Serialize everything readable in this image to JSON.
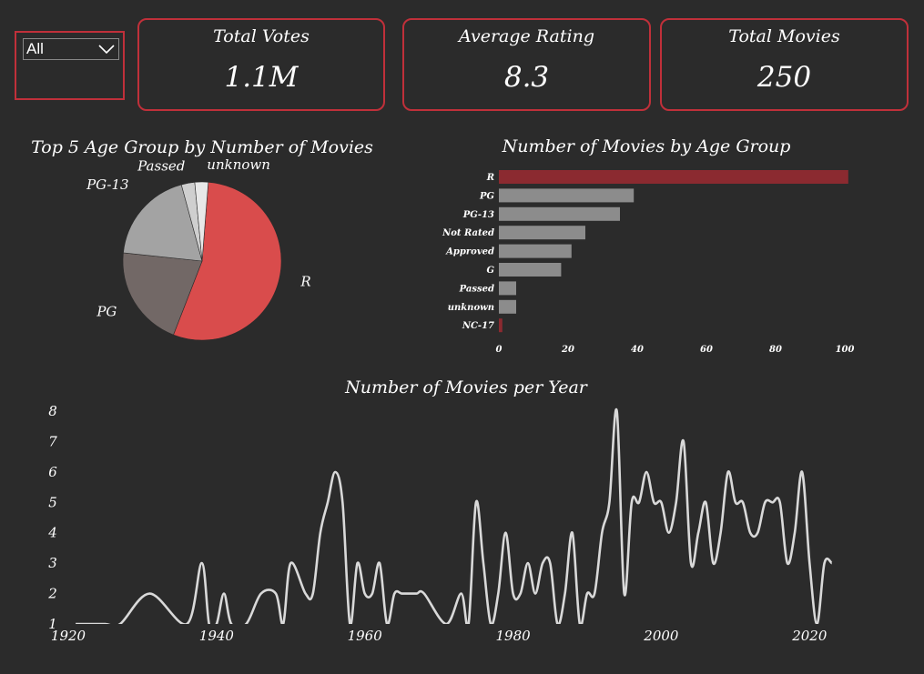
{
  "filter": {
    "selected": "All"
  },
  "cards": [
    {
      "title": "Total Votes",
      "value": "1.1M"
    },
    {
      "title": "Average Rating",
      "value": "8.3"
    },
    {
      "title": "Total Movies",
      "value": "250"
    }
  ],
  "colors": {
    "accent": "#c0303a",
    "background": "#2b2b2b",
    "bar_default": "#8c8c8c",
    "bar_highlight": "#8b2a30",
    "line": "#d9d9d9"
  },
  "chart_data": [
    {
      "type": "pie",
      "title": "Top 5 Age Group by Number of Movies",
      "categories": [
        "R",
        "PG",
        "PG-13",
        "Passed",
        "unknown"
      ],
      "values": [
        100,
        38,
        35,
        5,
        5
      ],
      "colors": [
        "#d94c4c",
        "#726866",
        "#a3a3a3",
        "#cfcfcf",
        "#e8e8e8"
      ]
    },
    {
      "type": "bar",
      "orientation": "horizontal",
      "title": "Number of Movies by Age Group",
      "categories": [
        "R",
        "PG",
        "PG-13",
        "Not Rated",
        "Approved",
        "G",
        "Passed",
        "unknown",
        "NC-17"
      ],
      "values": [
        101,
        39,
        35,
        25,
        21,
        18,
        5,
        5,
        1
      ],
      "highlight": [
        "R",
        "NC-17"
      ],
      "xticks": [
        0,
        20,
        40,
        60,
        80,
        100
      ],
      "xlim": [
        0,
        101
      ]
    },
    {
      "type": "line",
      "title": "Number of Movies per Year",
      "x": [
        1921,
        1922,
        1925,
        1927,
        1931,
        1936,
        1938,
        1939,
        1940,
        1941,
        1942,
        1944,
        1946,
        1948,
        1949,
        1950,
        1952,
        1953,
        1954,
        1955,
        1956,
        1957,
        1958,
        1959,
        1960,
        1961,
        1962,
        1963,
        1964,
        1965,
        1966,
        1967,
        1968,
        1971,
        1973,
        1974,
        1975,
        1976,
        1977,
        1978,
        1979,
        1980,
        1981,
        1982,
        1983,
        1984,
        1985,
        1986,
        1987,
        1988,
        1989,
        1990,
        1991,
        1992,
        1993,
        1994,
        1995,
        1996,
        1997,
        1998,
        1999,
        2000,
        2001,
        2002,
        2003,
        2004,
        2005,
        2006,
        2007,
        2008,
        2009,
        2010,
        2011,
        2012,
        2013,
        2014,
        2015,
        2016,
        2017,
        2018,
        2019,
        2020,
        2021,
        2022,
        2023
      ],
      "y": [
        1,
        1,
        1,
        1,
        2,
        1,
        3,
        1,
        1,
        2,
        1,
        1,
        2,
        2,
        1,
        3,
        2,
        2,
        4,
        5,
        6,
        5,
        1,
        3,
        2,
        2,
        3,
        1,
        2,
        2,
        2,
        2,
        2,
        1,
        2,
        1,
        5,
        3,
        1,
        2,
        4,
        2,
        2,
        3,
        2,
        3,
        3,
        1,
        2,
        4,
        1,
        2,
        2,
        4,
        5,
        8,
        2,
        5,
        5,
        6,
        5,
        5,
        4,
        5,
        7,
        3,
        4,
        5,
        3,
        4,
        6,
        5,
        5,
        4,
        4,
        5,
        5,
        5,
        3,
        4,
        6,
        3,
        1,
        3,
        3
      ],
      "yticks": [
        1,
        2,
        3,
        4,
        5,
        6,
        7,
        8
      ],
      "xticks": [
        1920,
        1940,
        1960,
        1980,
        2000,
        2020
      ],
      "ylim": [
        1,
        8
      ],
      "xlim": [
        1920,
        2025
      ]
    }
  ]
}
